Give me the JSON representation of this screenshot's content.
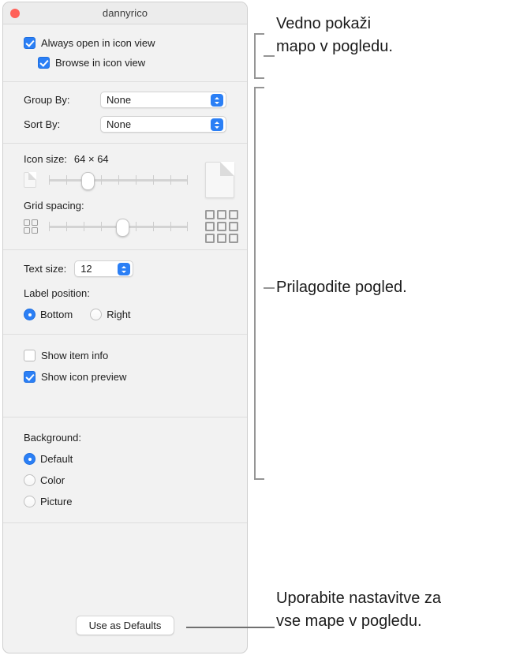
{
  "window": {
    "title": "dannyrico",
    "close_button": "close-button"
  },
  "view_section": {
    "always_open": {
      "label": "Always open in icon view",
      "checked": true
    },
    "browse_in": {
      "label": "Browse in icon view",
      "checked": true
    }
  },
  "arrange_section": {
    "group_by": {
      "label": "Group By:",
      "value": "None"
    },
    "sort_by": {
      "label": "Sort By:",
      "value": "None"
    }
  },
  "size_section": {
    "icon_size": {
      "label": "Icon size:",
      "value": "64 × 64",
      "ticks": 9,
      "position": 2
    },
    "grid_spacing": {
      "label": "Grid spacing:",
      "ticks": 9,
      "position": 4
    }
  },
  "text_section": {
    "text_size": {
      "label": "Text size:",
      "value": "12"
    },
    "label_position": {
      "label": "Label position:",
      "options": [
        {
          "label": "Bottom",
          "selected": true
        },
        {
          "label": "Right",
          "selected": false
        }
      ]
    }
  },
  "info_section": {
    "show_item_info": {
      "label": "Show item info",
      "checked": false
    },
    "show_icon_preview": {
      "label": "Show icon preview",
      "checked": true
    }
  },
  "background_section": {
    "label": "Background:",
    "options": [
      {
        "label": "Default",
        "selected": true
      },
      {
        "label": "Color",
        "selected": false
      },
      {
        "label": "Picture",
        "selected": false
      }
    ]
  },
  "footer": {
    "use_as_defaults": "Use as Defaults"
  },
  "callouts": {
    "top": "Vedno pokaži\nmapo v pogledu.",
    "middle": "Prilagodite pogled.",
    "bottom": "Uporabite nastavitve za\nvse mape v pogledu."
  },
  "colors": {
    "accent": "#2b7ff5",
    "close_red": "#ff6159",
    "window_bg": "#f2f2f2",
    "callout_line": "#959595"
  }
}
